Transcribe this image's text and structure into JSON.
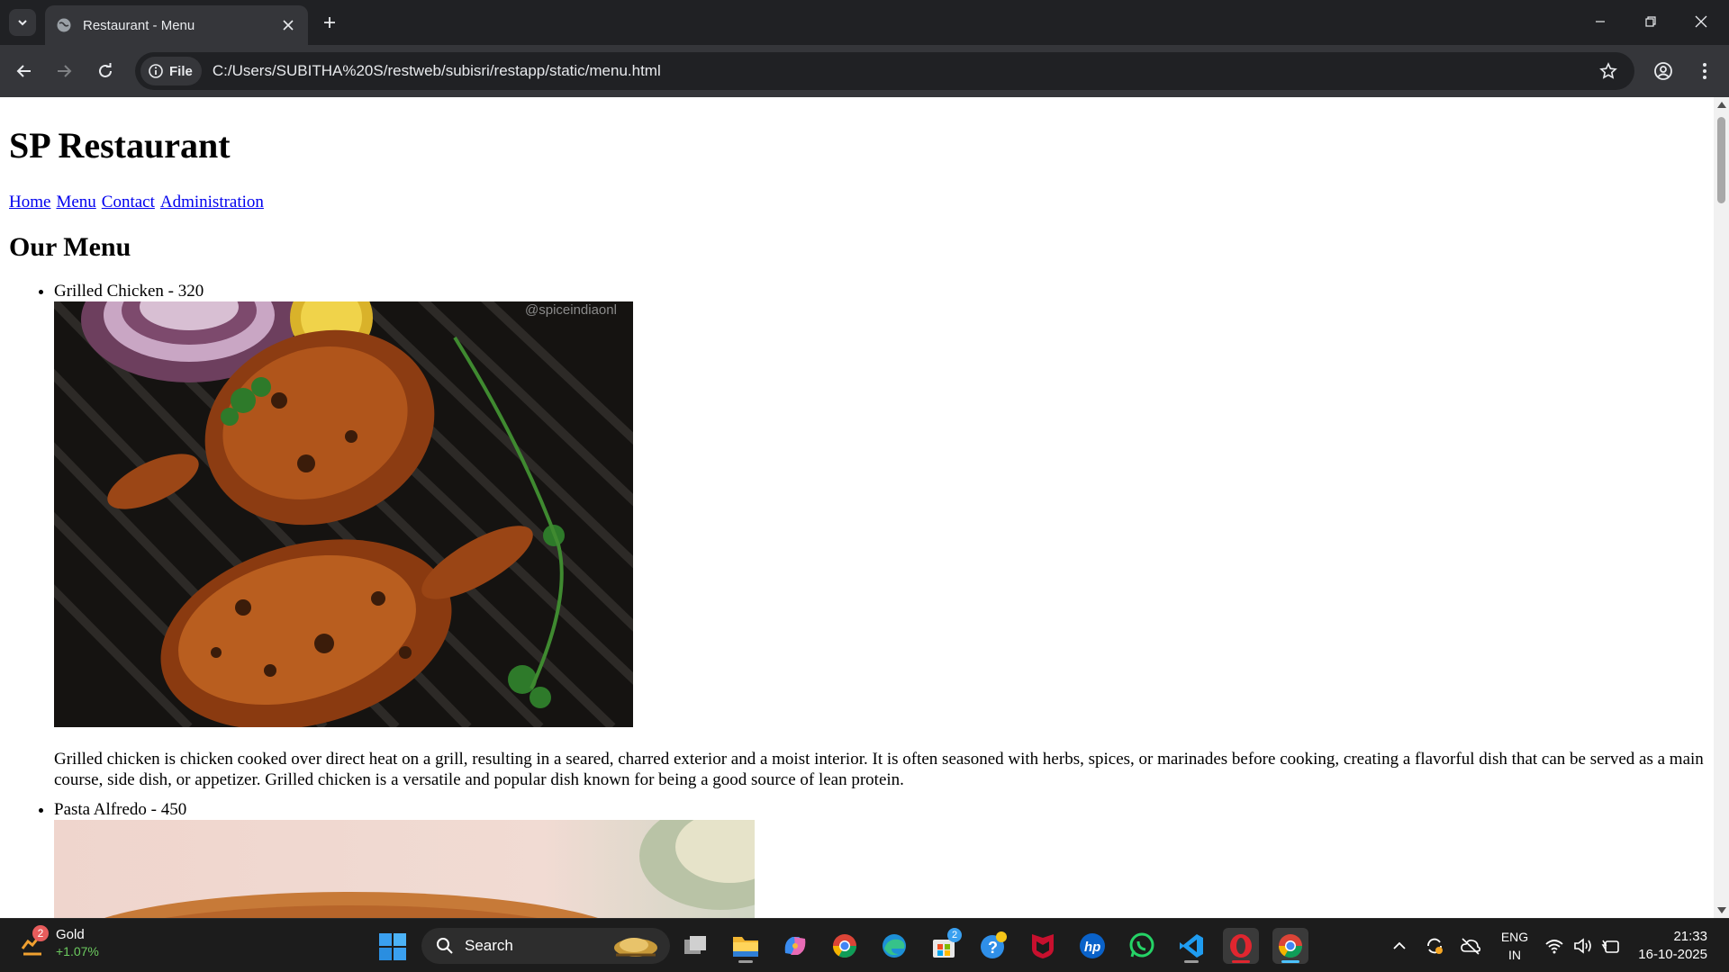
{
  "browser": {
    "tab_title": "Restaurant - Menu",
    "chip_label": "File",
    "url": "C:/Users/SUBITHA%20S/restweb/subisri/restapp/static/menu.html"
  },
  "page": {
    "site_title": "SP Restaurant",
    "nav": [
      "Home",
      "Menu",
      "Contact",
      "Administration"
    ],
    "heading": "Our Menu",
    "items": [
      {
        "name": "Grilled Chicken - 320",
        "watermark": "@spiceindiaonl",
        "description": "Grilled chicken is chicken cooked over direct heat on a grill, resulting in a seared, charred exterior and a moist interior. It is often seasoned with herbs, spices, or marinades before cooking, creating a flavorful dish that can be served as a main course, side dish, or appetizer. Grilled chicken is a versatile and popular dish known for being a good source of lean protein."
      },
      {
        "name": "Pasta Alfredo - 450"
      }
    ]
  },
  "taskbar": {
    "widget_label": "Gold",
    "widget_change": "+1.07%",
    "widget_badge": "2",
    "search_label": "Search",
    "store_badge": "2",
    "lang_top": "ENG",
    "lang_bottom": "IN",
    "time": "21:33",
    "date": "16-10-2025"
  },
  "colors": {
    "chrome_dark": "#202124",
    "chrome_toolbar": "#35363a",
    "link": "#0000ee",
    "taskbar": "#1c1c1c"
  }
}
